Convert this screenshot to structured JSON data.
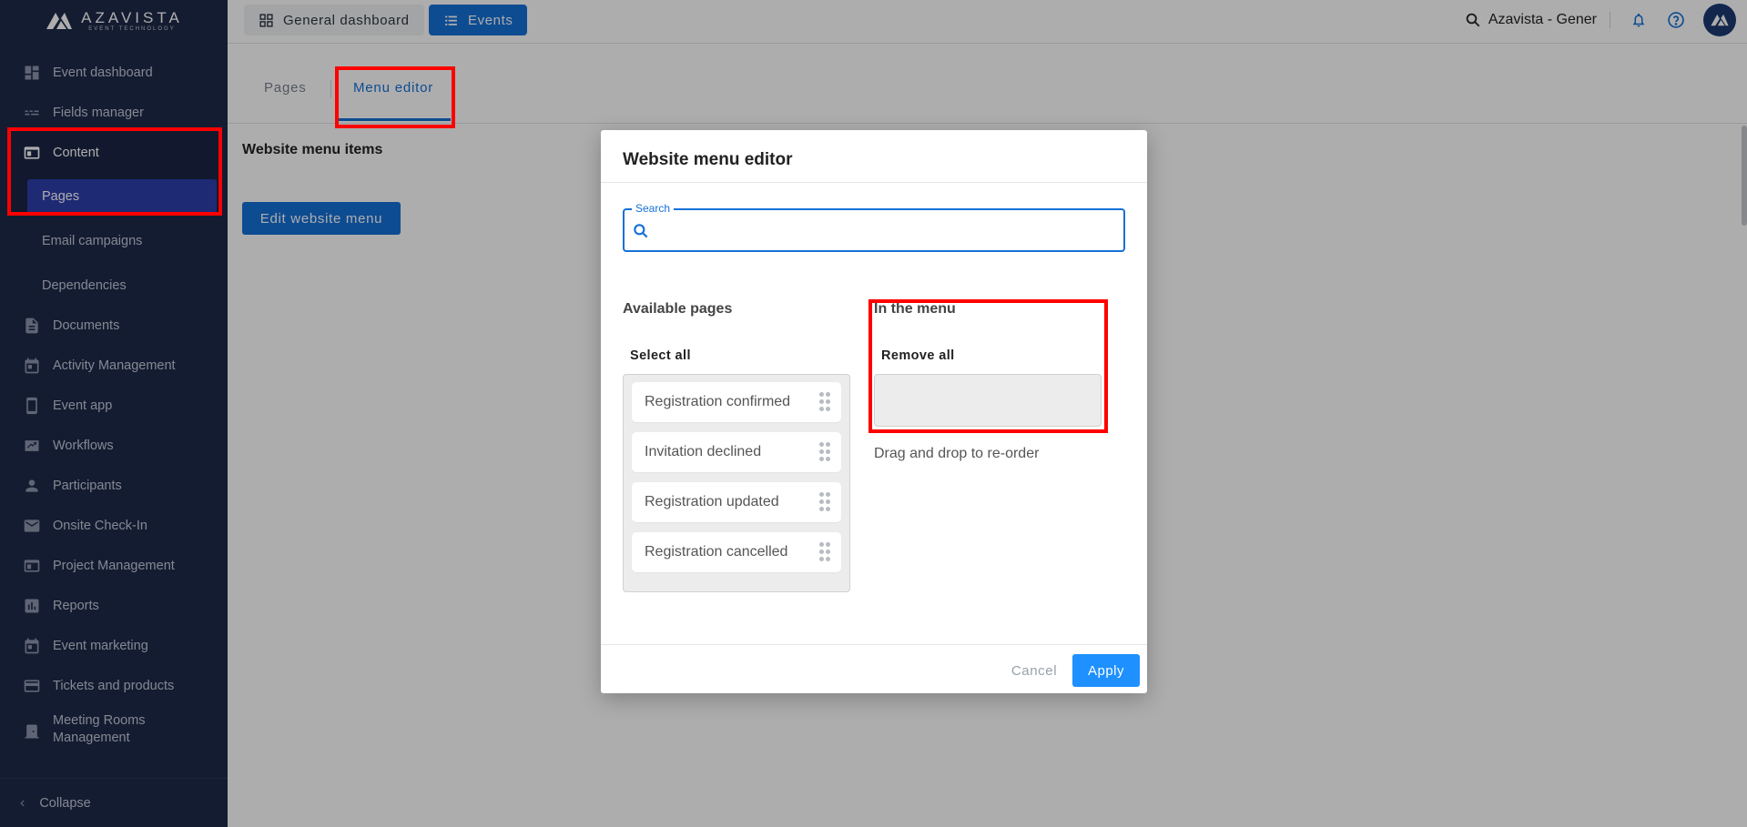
{
  "app": {
    "logo_text": "AZAVISTA",
    "logo_subtext": "EVENT TECHNOLOGY"
  },
  "sidebar": {
    "items": [
      {
        "label": "Event dashboard",
        "icon": "dashboard-icon"
      },
      {
        "label": "Fields manager",
        "icon": "fields-icon"
      },
      {
        "label": "Content",
        "icon": "content-icon"
      },
      {
        "label": "Pages",
        "icon": ""
      },
      {
        "label": "Email campaigns",
        "icon": ""
      },
      {
        "label": "Dependencies",
        "icon": ""
      },
      {
        "label": "Documents",
        "icon": "document-icon"
      },
      {
        "label": "Activity Management",
        "icon": "calendar-icon"
      },
      {
        "label": "Event app",
        "icon": "phone-icon"
      },
      {
        "label": "Workflows",
        "icon": "workflow-icon"
      },
      {
        "label": "Participants",
        "icon": "person-icon"
      },
      {
        "label": "Onsite Check-In",
        "icon": "mail-icon"
      },
      {
        "label": "Project Management",
        "icon": "board-icon"
      },
      {
        "label": "Reports",
        "icon": "chart-icon"
      },
      {
        "label": "Event marketing",
        "icon": "calendar-icon"
      },
      {
        "label": "Tickets and products",
        "icon": "card-icon"
      },
      {
        "label": "Meeting Rooms Management",
        "icon": "door-icon"
      }
    ],
    "collapse_label": "Collapse"
  },
  "topbar": {
    "general_dashboard_label": "General dashboard",
    "events_label": "Events",
    "search_text": "Azavista - Gener"
  },
  "main": {
    "tabs": [
      {
        "label": "Pages"
      },
      {
        "label": "Menu editor"
      }
    ],
    "section_title": "Website menu items",
    "edit_button_label": "Edit website menu"
  },
  "modal": {
    "title": "Website menu editor",
    "search_label": "Search",
    "search_value": "",
    "available_title": "Available pages",
    "select_all_label": "Select all",
    "available_items": [
      {
        "label": "Registration confirmed"
      },
      {
        "label": "Invitation declined"
      },
      {
        "label": "Registration updated"
      },
      {
        "label": "Registration cancelled"
      }
    ],
    "menu_title": "In the menu",
    "remove_all_label": "Remove all",
    "menu_items": [],
    "drag_hint": "Drag and drop to re-order",
    "cancel_label": "Cancel",
    "apply_label": "Apply"
  },
  "colors": {
    "sidebar_bg": "#1e2a4a",
    "accent": "#1670d8",
    "apply": "#1e90ff",
    "highlight": "#ff0000"
  }
}
